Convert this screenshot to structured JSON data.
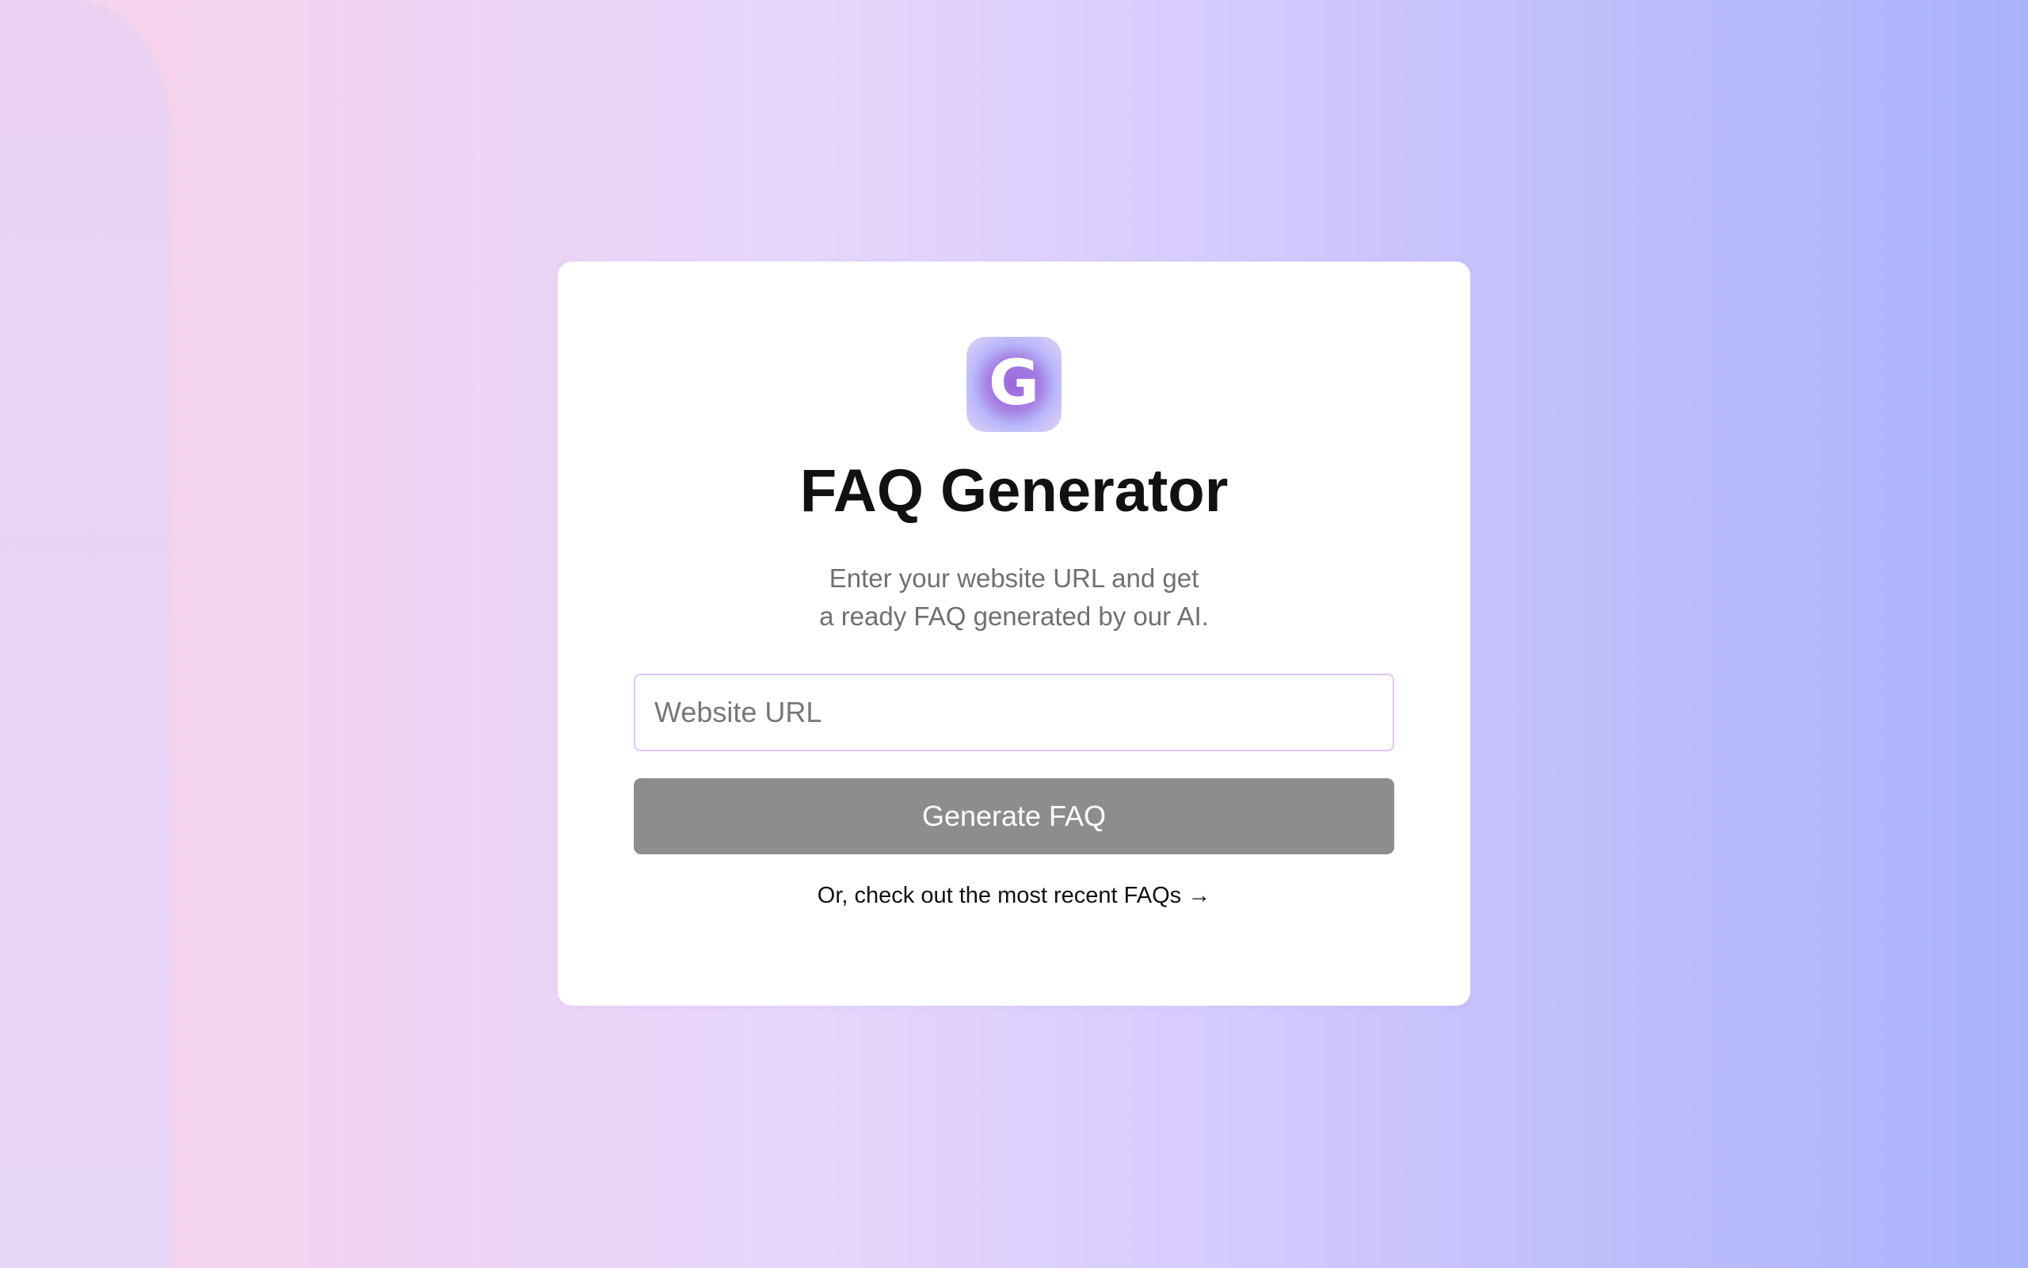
{
  "app": {
    "logo_letter": "G",
    "title": "FAQ Generator",
    "subtitle_line1": "Enter your website URL and get",
    "subtitle_line2": "a ready FAQ generated by our AI."
  },
  "form": {
    "url_placeholder": "Website URL",
    "url_value": "",
    "generate_label": "Generate FAQ"
  },
  "footer": {
    "recent_link": "Or, check out the most recent FAQs →"
  },
  "colors": {
    "button_bg": "#8d8d8d",
    "input_border": "#e3c6f5",
    "logo_accent": "#9a6ad9"
  }
}
